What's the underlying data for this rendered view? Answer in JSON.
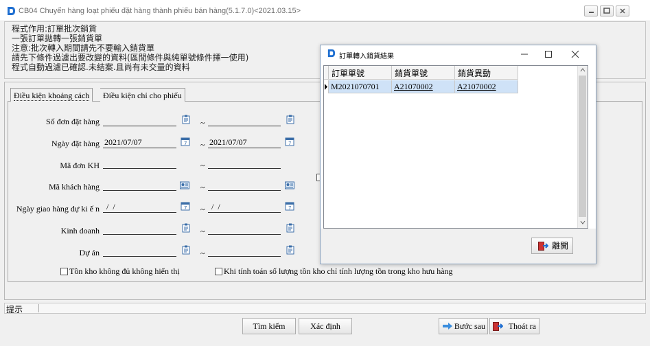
{
  "window": {
    "title": "CB04 Chuyển hàng loạt phiếu đặt hàng thành phiếu bán hàng(5.1.7.0)<2021.03.15>"
  },
  "description": [
    "程式作用:訂單批次銷貨",
    "一張訂單拋轉一張銷貨單",
    "注意:批次轉入期間請先不要輸入銷貨單",
    "請先下條件過濾出要改變的資料(區間條件與純單號條件擇一使用)",
    "程式自動過濾已確認.未結案.且尚有未交量的資料"
  ],
  "tabs": [
    {
      "label": "Điều kiện khoảng cách"
    },
    {
      "label": "Điều kiện chỉ cho phiếu"
    }
  ],
  "form": {
    "order_no": {
      "label": "Số đơn đặt hàng",
      "from": "",
      "to": ""
    },
    "order_date": {
      "label": "Ngày đặt hàng",
      "from": "2021/07/07",
      "to": "2021/07/07"
    },
    "customer_order_no": {
      "label": "Mã đơn KH",
      "from": "",
      "to": ""
    },
    "customer_code": {
      "label": "Mã khách hàng",
      "from": "",
      "to": ""
    },
    "expected_delivery": {
      "label": "Ngày giao hàng dự ki ế n",
      "from": " /  /",
      "to": " /  /"
    },
    "sales": {
      "label": "Kinh doanh",
      "from": "",
      "to": ""
    },
    "project": {
      "label": "Dự án",
      "from": "",
      "to": ""
    },
    "tilde": "~",
    "check_hide_insufficient": "Tồn kho không đủ không hiển thị",
    "check_bonded_stock": "Khi tính toán số lượng tồn kho chỉ tính lượng tồn trong kho hưu hàng"
  },
  "status": {
    "label": "提示"
  },
  "buttons": {
    "search": "Tìm kiếm",
    "confirm": "Xác định",
    "next": "Bước sau",
    "exit": "Thoát ra"
  },
  "dialog": {
    "title": "訂單轉入銷貨結果",
    "columns": [
      "訂單單號",
      "銷貨單號",
      "銷貨異動"
    ],
    "rows": [
      {
        "order": "M2021070701",
        "sale": "A21070002",
        "change": "A21070002"
      }
    ],
    "leave_button": "離開"
  },
  "colors": {
    "selected_row": "#cfe2f7",
    "accent": "#1f6fd1"
  }
}
